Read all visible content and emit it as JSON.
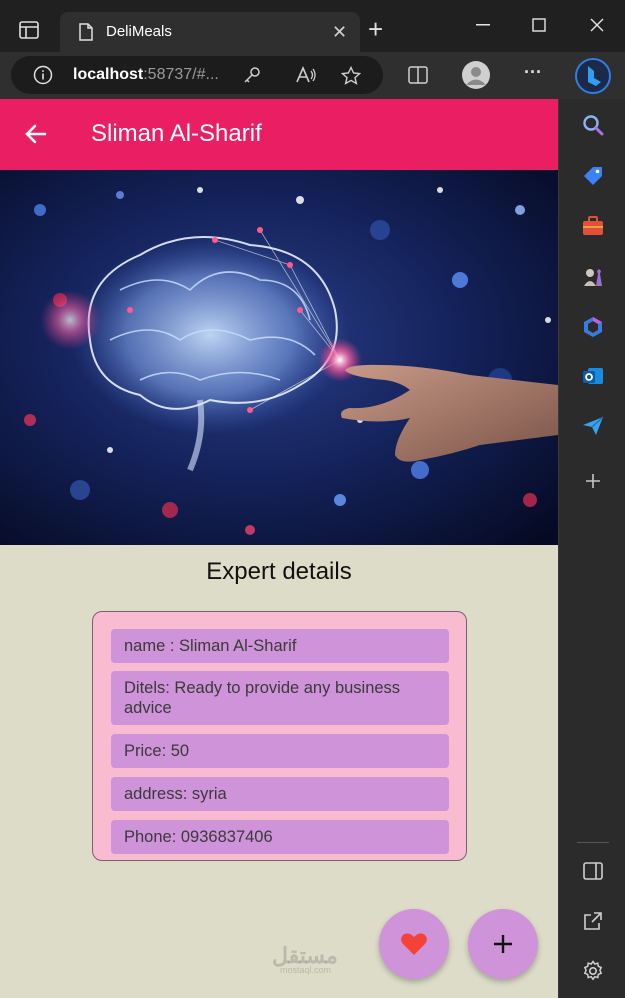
{
  "browser": {
    "tab_title": "DeliMeals",
    "address_host": "localhost",
    "address_rest": ":58737/#...",
    "close_glyph": "✕",
    "new_tab_glyph": "+",
    "more_glyph": "···"
  },
  "app": {
    "appbar_color": "#e91e63",
    "title": "Sliman Al-Sharif",
    "section_title": "Expert details",
    "details": [
      {
        "text": "name : Sliman Al-Sharif"
      },
      {
        "text": "Ditels: Ready to provide any business advice"
      },
      {
        "text": "Price: 50"
      },
      {
        "text": "address: syria"
      },
      {
        "text": "Phone: 0936837406"
      }
    ],
    "watermark": "مستقل",
    "watermark_sub": "mostaql.com"
  },
  "icons": {
    "back": "arrow-left-icon",
    "favorite": "heart-icon",
    "add": "plus-icon"
  }
}
